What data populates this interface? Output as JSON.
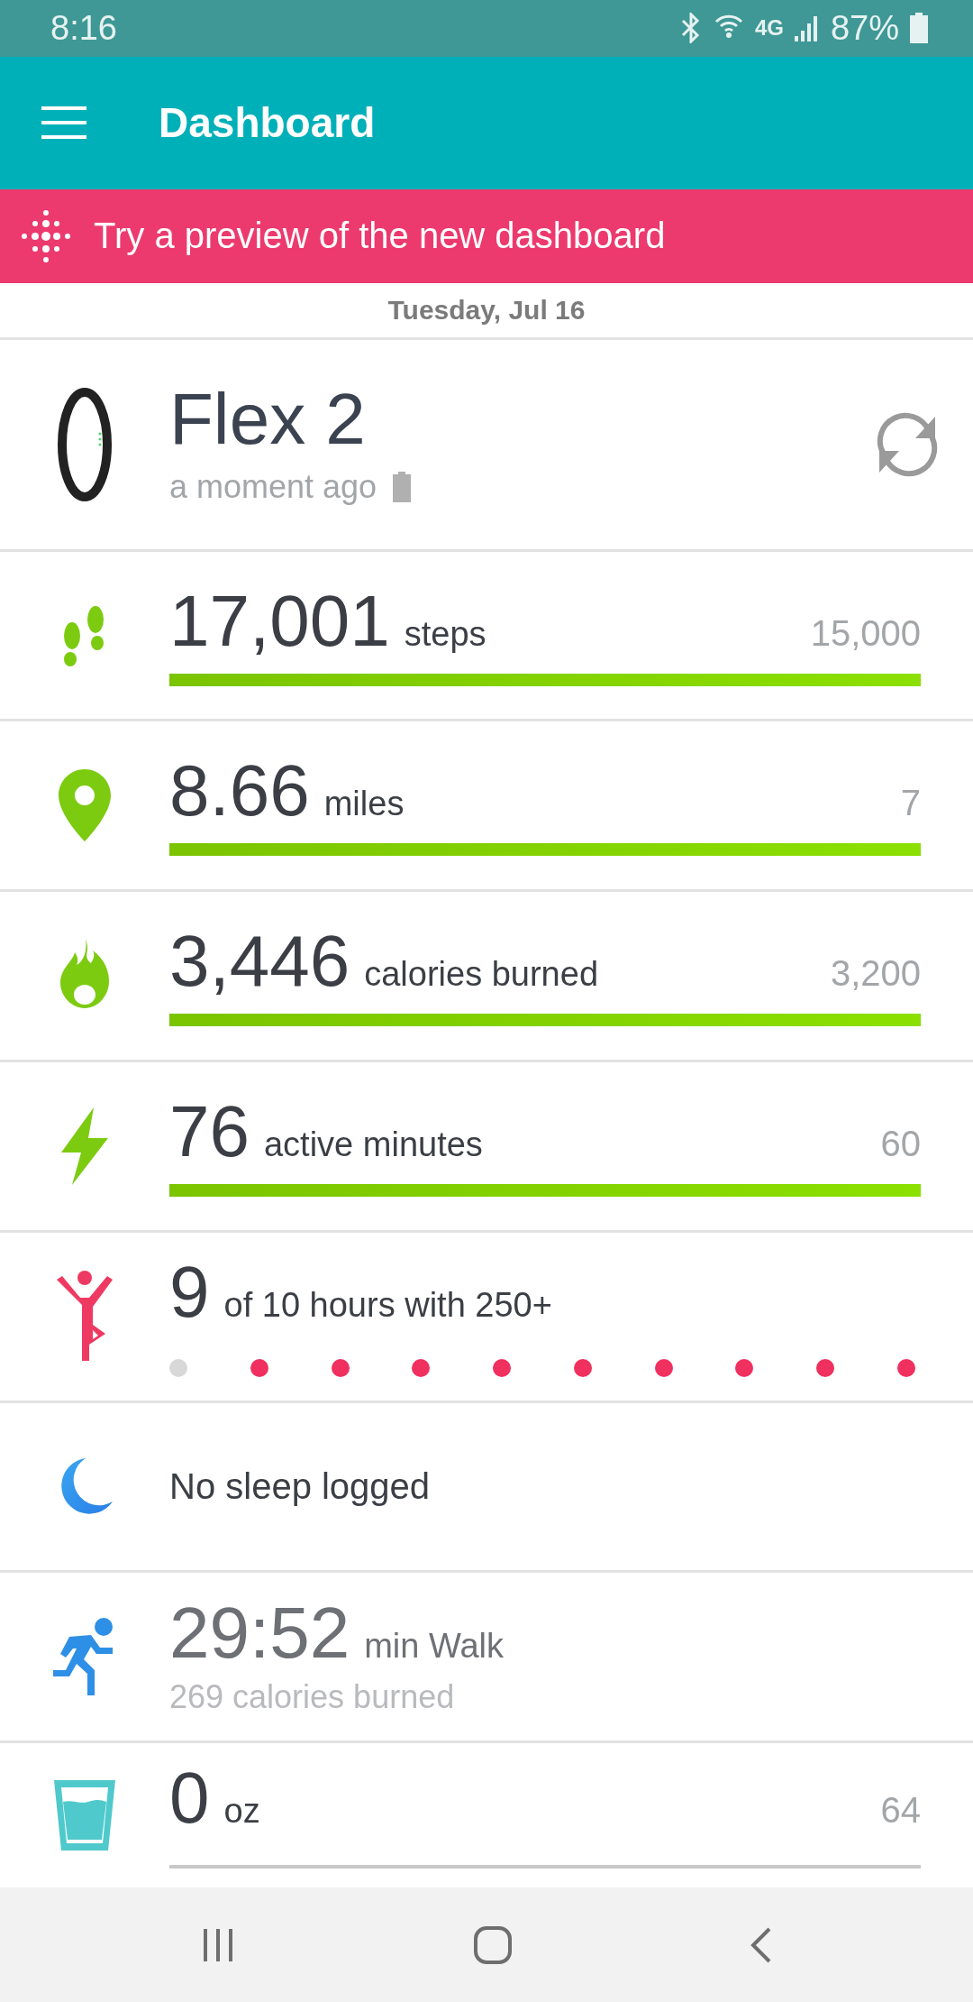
{
  "status_bar": {
    "time": "8:16",
    "network": "4G",
    "battery": "87%"
  },
  "header": {
    "title": "Dashboard"
  },
  "banner": {
    "text": "Try a preview of the new dashboard"
  },
  "date": "Tuesday, Jul 16",
  "device": {
    "name": "Flex 2",
    "synced": "a moment ago"
  },
  "stats": [
    {
      "kind": "steps",
      "value": "17,001",
      "unit": "steps",
      "goal": "15,000",
      "level": 1
    },
    {
      "kind": "distance",
      "value": "8.66",
      "unit": "miles",
      "goal": "7",
      "level": 1
    },
    {
      "kind": "calories",
      "value": "3,446",
      "unit": "calories burned",
      "goal": "3,200",
      "level": 1
    },
    {
      "kind": "active",
      "value": "76",
      "unit": "active minutes",
      "goal": "60",
      "level": 1
    },
    {
      "kind": "hourly",
      "value": "9",
      "unit": "of 10 hours with 250+",
      "dots": [
        {
          "on": false
        },
        {
          "on": true
        },
        {
          "on": true
        },
        {
          "on": true
        },
        {
          "on": true
        },
        {
          "on": true
        },
        {
          "on": true
        },
        {
          "on": true
        },
        {
          "on": true
        },
        {
          "on": true
        }
      ]
    },
    {
      "kind": "sleep",
      "text": "No sleep logged"
    },
    {
      "kind": "exercise",
      "value": "29:52",
      "unit": "min Walk",
      "detail": "269 calories burned"
    },
    {
      "kind": "water",
      "value": "0",
      "unit": "oz",
      "goal": "64",
      "level": 0
    }
  ]
}
